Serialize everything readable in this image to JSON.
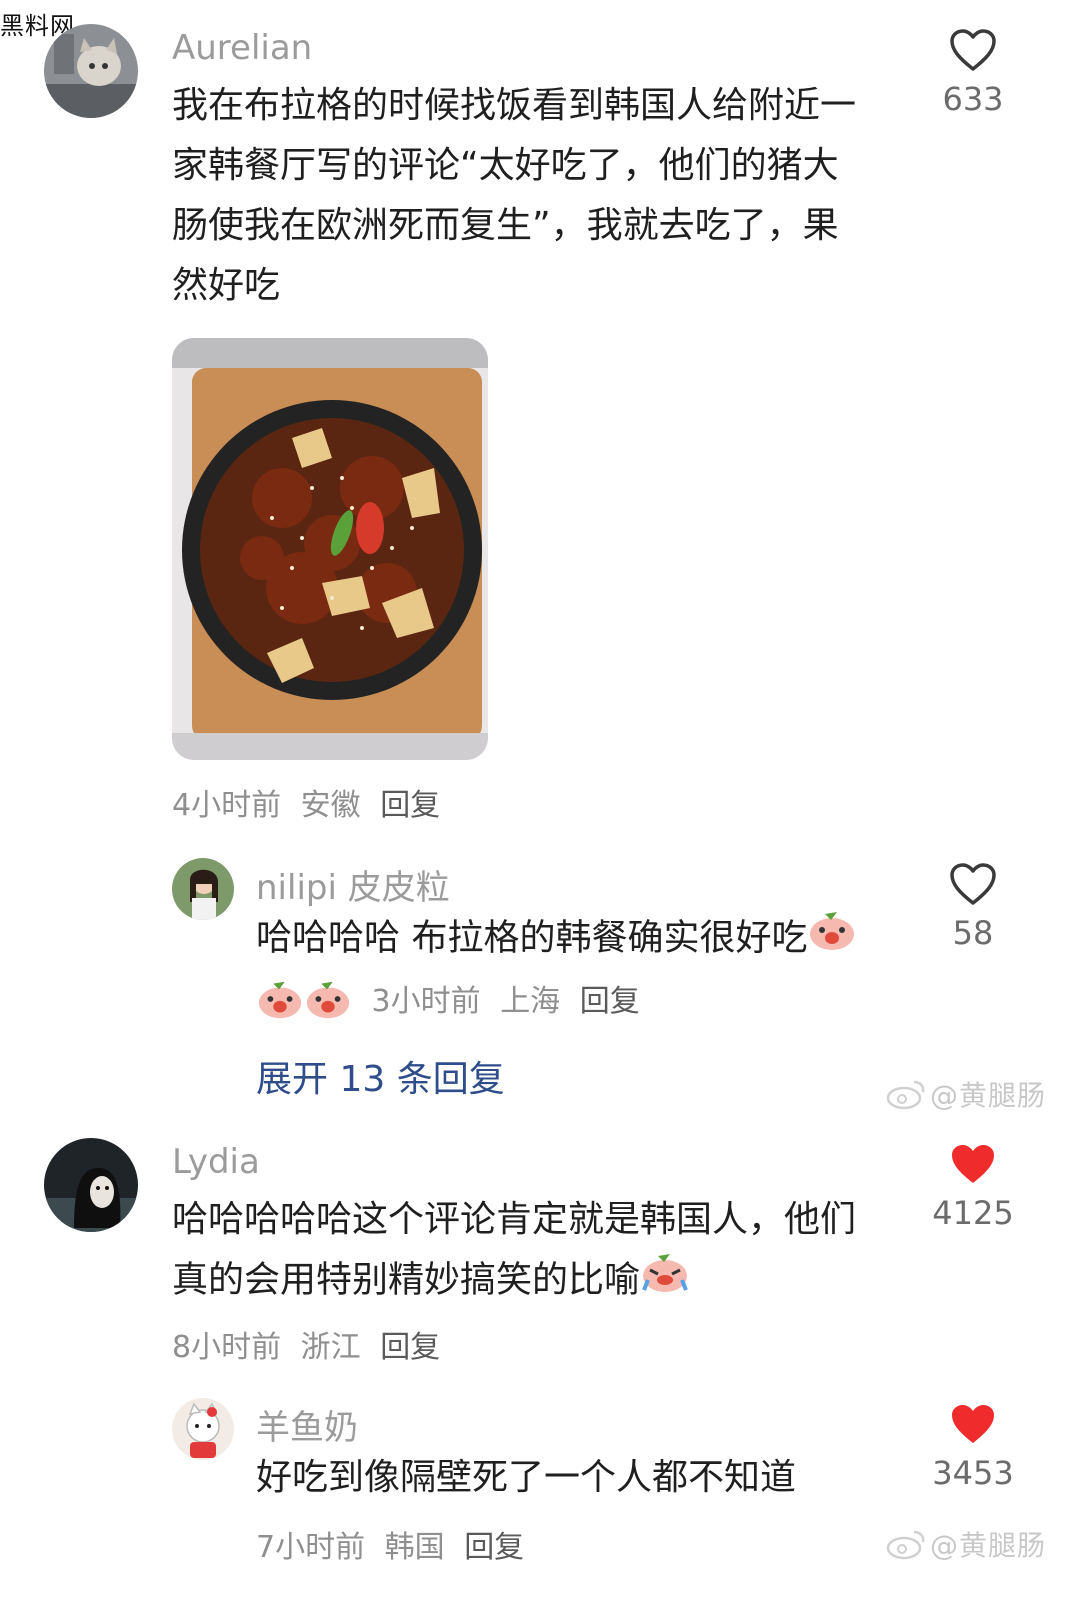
{
  "watermark_top": "黑料网",
  "watermark_weibo": "@黄腿肠",
  "comments": [
    {
      "user": "Aurelian",
      "text": "我在布拉格的时候找饭看到韩国人给附近一家韩餐厅写的评论“太好吃了，他们的猪大肠使我在欧洲死而复生”，我就去吃了，果然好吃",
      "lines": [
        "我在布拉格的时候找饭看到韩国人给附近一",
        "家韩餐厅写的评论“太好吃了，他们的猪大",
        "肠使我在欧洲死而复生”，我就去吃了，果",
        "然好吃"
      ],
      "time": "4小时前",
      "location": "安徽",
      "reply_label": "回复",
      "likes": "633",
      "liked": false,
      "image": "food-photo"
    },
    {
      "user": "nilipi 皮皮粒",
      "text": "哈哈哈哈 布拉格的韩餐确实很好吃",
      "time": "3小时前",
      "location": "上海",
      "reply_label": "回复",
      "likes": "58",
      "liked": false
    },
    {
      "user": "Lydia",
      "lines": [
        "哈哈哈哈哈这个评论肯定就是韩国人，他们",
        "真的会用特别精妙搞笑的比喻"
      ],
      "time": "8小时前",
      "location": "浙江",
      "reply_label": "回复",
      "likes": "4125",
      "liked": true
    },
    {
      "user": "羊鱼奶",
      "text": "好吃到像隔壁死了一个人都不知道",
      "time": "7小时前",
      "location": "韩国",
      "reply_label": "回复",
      "likes": "3453",
      "liked": true
    }
  ],
  "expand_replies": "展开 13 条回复",
  "colors": {
    "liked": "#f02b2b",
    "link": "#2f4d8a",
    "meta": "#8f8f8f"
  },
  "icons": [
    "heart-outline-icon",
    "heart-filled-icon",
    "pig-emoji-icon",
    "weibo-logo-icon"
  ]
}
